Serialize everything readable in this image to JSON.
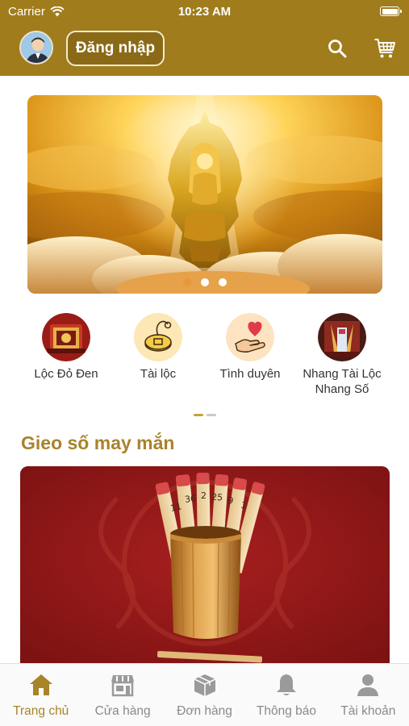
{
  "status_bar": {
    "carrier": "Carrier",
    "time": "10:23 AM"
  },
  "header": {
    "login_label": "Đăng nhập",
    "icons": [
      "avatar",
      "search-icon",
      "cart-icon"
    ]
  },
  "banner": {
    "slide_count": 3,
    "active_slide": 1
  },
  "categories": [
    {
      "label": "Lộc Đỏ Đen",
      "icon": "red-black-luck-icon"
    },
    {
      "label": "Tài lộc",
      "icon": "fortune-coin-icon"
    },
    {
      "label": "Tình duyên",
      "icon": "heart-hand-icon"
    },
    {
      "label": "Nhang Tài Lộc Nhang Số",
      "icon": "incense-icon"
    }
  ],
  "section": {
    "title": "Gieo số may mắn"
  },
  "lucky_sticks": [
    "11",
    "36",
    "2",
    "25",
    "9",
    "1"
  ],
  "tabs": [
    {
      "label": "Trang chủ",
      "icon": "home-icon",
      "active": true
    },
    {
      "label": "Cửa hàng",
      "icon": "store-icon",
      "active": false
    },
    {
      "label": "Đơn hàng",
      "icon": "box-icon",
      "active": false
    },
    {
      "label": "Thông báo",
      "icon": "bell-icon",
      "active": false
    },
    {
      "label": "Tài khoản",
      "icon": "user-icon",
      "active": false
    }
  ],
  "colors": {
    "brand_gold": "#a07c1c",
    "title_gold": "#a9832b",
    "tab_active": "#a88428",
    "tab_inactive": "#8a8a8a",
    "dot_active": "#e8973a"
  }
}
